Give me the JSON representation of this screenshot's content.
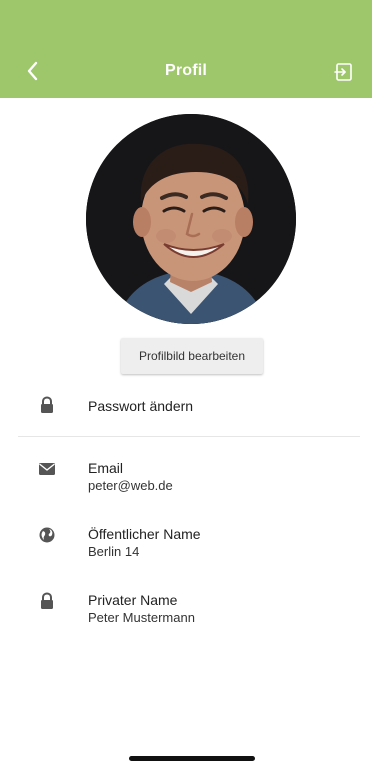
{
  "header": {
    "title": "Profil",
    "background": "#9ec66a",
    "back_icon": "chevron-left-icon",
    "logout_icon": "logout-icon"
  },
  "profile": {
    "edit_photo_label": "Profilbild bearbeiten",
    "change_password_label": "Passwort ändern",
    "fields": [
      {
        "icon": "mail-icon",
        "label": "Email",
        "value": "peter@web.de"
      },
      {
        "icon": "globe-icon",
        "label": "Öffentlicher Name",
        "value": "Berlin 14"
      },
      {
        "icon": "lock-icon",
        "label": "Privater Name",
        "value": "Peter Mustermann"
      }
    ]
  }
}
